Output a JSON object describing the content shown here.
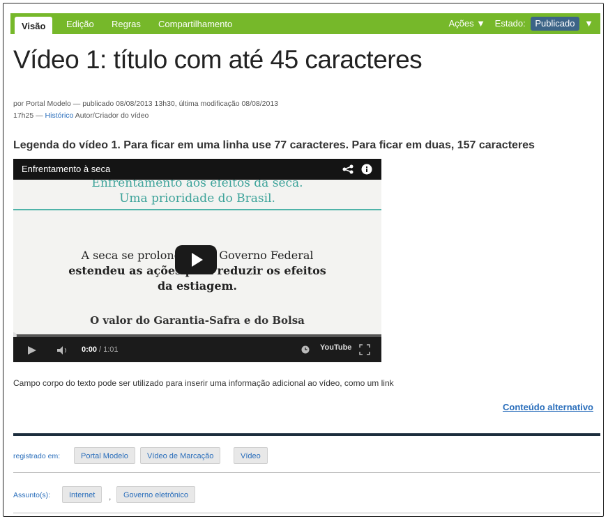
{
  "toolbar": {
    "tabs": [
      "Visão",
      "Edição",
      "Regras",
      "Compartilhamento"
    ],
    "actions_label": "Ações ▼",
    "state_label": "Estado:",
    "state_value": "Publicado",
    "state_arrow": "▼"
  },
  "page": {
    "title": "Vídeo 1: título com até 45 caracteres",
    "meta_line1": "por Portal Modelo — publicado 08/08/2013 13h30, última modificação 08/08/2013",
    "meta_line2_prefix": "17h25 — ",
    "history_link": "Histórico",
    "meta_line2_suffix": " Autor/Criador do vídeo",
    "caption": "Legenda do vídeo 1. Para ficar em uma linha use 77 caracteres. Para ficar em duas, 157 caracteres"
  },
  "video": {
    "title": "Enfrentamento à seca",
    "slide_top_1": "Enfrentamento aos efeitos da seca.",
    "slide_top_2": "Uma prioridade do Brasil.",
    "slide_body_1": "A seca se prolongou e o Governo Federal",
    "slide_body_2": "estendeu as ações para reduzir os efeitos",
    "slide_body_3": "da estiagem.",
    "slide_bottom": "O valor do Garantia-Safra e do Bolsa",
    "time_current": "0:00",
    "time_total": " / 1:01",
    "youtube_label": "YouTube",
    "progress_fraction": 0.0,
    "icons": [
      "share-icon",
      "info-icon",
      "play-icon",
      "volume-icon",
      "clock-icon",
      "fullscreen-icon"
    ]
  },
  "content": {
    "body_text": "Campo corpo do texto pode ser utilizado para inserir uma informação adicional ao vídeo, como um link",
    "alt_link": "Conteúdo alternativo"
  },
  "tags": {
    "registered_label": "registrado em:",
    "registered": [
      "Portal Modelo",
      "Vídeo de Marcação",
      "Vídeo"
    ],
    "subject_label": "Assunto(s):",
    "subjects": [
      "Internet",
      "Governo eletrônico"
    ],
    "separator": ","
  },
  "colors": {
    "toolbar_green": "#76b82a",
    "badge_blue": "#3c6487",
    "link_blue": "#2a6ebb",
    "rule_navy": "#1c2d3d"
  }
}
